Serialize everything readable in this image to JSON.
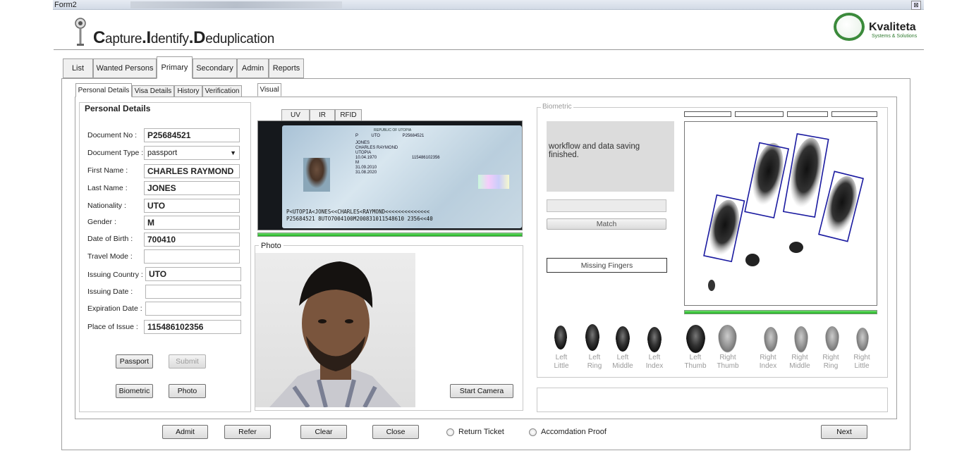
{
  "window": {
    "title": "Form2",
    "close": "⊠"
  },
  "app": {
    "title_parts": [
      "C",
      "apture",
      ".",
      "I",
      "dentify",
      ".",
      "D",
      "eduplication"
    ],
    "logo_name": "Kvaliteta",
    "logo_sub": "Systems & Solutions"
  },
  "main_tabs": [
    "List",
    "Wanted Persons",
    "Primary",
    "Secondary",
    "Admin",
    "Reports"
  ],
  "sub_tabs": [
    "Personal Details",
    "Visa Details",
    "History",
    "Verification"
  ],
  "personal": {
    "heading": "Personal Details",
    "fields": [
      {
        "label": "Document No :",
        "value": "P25684521"
      },
      {
        "label": "Document Type :",
        "value": "passport"
      },
      {
        "label": "First Name :",
        "value": "CHARLES RAYMOND"
      },
      {
        "label": "Last Name :",
        "value": "JONES"
      },
      {
        "label": "Nationality :",
        "value": "UTO"
      },
      {
        "label": "Gender :",
        "value": "M"
      },
      {
        "label": "Date of Birth :",
        "value": "700410"
      },
      {
        "label": "Travel Mode :",
        "value": ""
      },
      {
        "label": "Issuing Country :",
        "value": "UTO"
      },
      {
        "label": "Issuing Date :",
        "value": ""
      },
      {
        "label": "Expiration Date :",
        "value": ""
      },
      {
        "label": "Place of Issue :",
        "value": "115486102356"
      }
    ],
    "buttons": {
      "passport": "Passport",
      "submit": "Submit",
      "biometric": "Biometric",
      "photo": "Photo"
    }
  },
  "doc_tabs": [
    "Visual",
    "UV",
    "IR",
    "RFID"
  ],
  "passport_image": {
    "header": "REPUBLIC OF UTOPIA",
    "type": "P",
    "code": "UTO",
    "number": "P25684521",
    "surname": "JONES",
    "given": "CHARLES RAYMOND",
    "nationality": "UTOPIA",
    "dob": "10.04.1970",
    "sex": "M",
    "issue": "31.09.2010",
    "expiry": "31.08.2020",
    "place": "115486102356",
    "mrz1": "P<UTOPIA<JONES<<CHARLES<RAYMOND<<<<<<<<<<<<<<",
    "mrz2": "P25684521 8UTO7004100M200831011548610 2356<<40"
  },
  "photo": {
    "legend": "Photo",
    "start_camera": "Start Camera"
  },
  "biometric": {
    "legend": "Biometric",
    "status": "workflow and data saving finished.",
    "match": "Match",
    "missing": "Missing Fingers",
    "finger_labels": [
      [
        "Left",
        "Little"
      ],
      [
        "Left",
        "Ring"
      ],
      [
        "Left",
        "Middle"
      ],
      [
        "Left",
        "Index"
      ],
      [
        "Left",
        "Thumb"
      ],
      [
        "Right",
        "Thumb"
      ],
      [
        "Right",
        "Index"
      ],
      [
        "Right",
        "Middle"
      ],
      [
        "Right",
        "Ring"
      ],
      [
        "Right",
        "Little"
      ]
    ]
  },
  "bottom": {
    "admit": "Admit",
    "refer": "Refer",
    "clear": "Clear",
    "close": "Close",
    "return_ticket": "Return Ticket",
    "accomodation": "Accomdation Proof",
    "next": "Next"
  },
  "colors": {
    "progress": "#22b522",
    "roi": "#1a1aa0"
  }
}
